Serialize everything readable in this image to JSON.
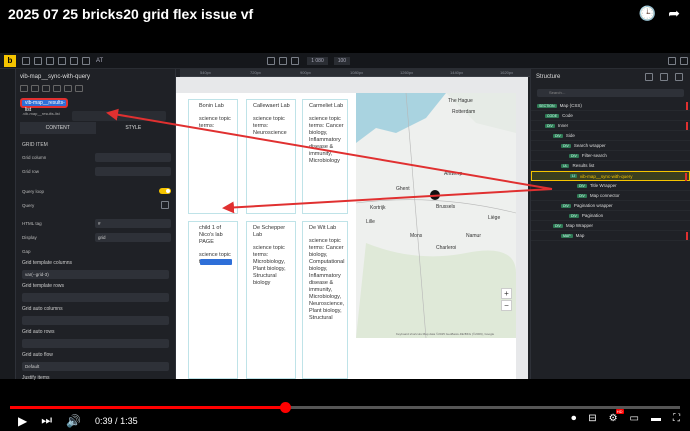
{
  "video": {
    "title": "2025 07 25 bricks20 grid flex issue vf",
    "time_current": "0:39",
    "time_separator": "/",
    "time_total": "1:35",
    "progress": 0.41
  },
  "builder": {
    "logo": "b",
    "toolbar_at": "AT",
    "width_label": "1 080",
    "zoom_label": "100",
    "element_title": "vib-map__sync-with-query",
    "class_chip": "vib-map__results-list",
    "class_sub": ".vib-map__results-list",
    "tabs": {
      "content": "CONTENT",
      "style": "STYLE"
    },
    "grid_item": {
      "heading": "GRID ITEM",
      "grid_column": "Grid column",
      "grid_row": "Grid row"
    },
    "query_loop": "Query loop",
    "query": "Query",
    "html_tag": {
      "label": "HTML tag",
      "value": "#"
    },
    "display": {
      "label": "Display",
      "value": "grid"
    },
    "gap": "Gap",
    "grid_template_columns": {
      "label": "Grid template columns",
      "value": "var(--grid-3)"
    },
    "grid_template_rows": "Grid template rows",
    "grid_auto_columns": "Grid auto columns",
    "grid_auto_rows": "Grid auto rows",
    "grid_auto_flow": {
      "label": "Grid auto flow",
      "value": "Default"
    },
    "justify_items": "Justify items"
  },
  "canvas": {
    "ruler_ticks": [
      "540px",
      "720px",
      "900px",
      "1080px",
      "1260px",
      "1440px",
      "1620px"
    ],
    "cards": [
      {
        "title": "Bonin Lab",
        "body": "science topic terms:"
      },
      {
        "title": "Callewaert Lab",
        "body": "science topic terms: Neuroscience"
      },
      {
        "title": "Carmeliet Lab",
        "body": "science topic terms: Cancer biology, Inflammatory disease & immunity, Microbiology"
      },
      {
        "title": "child 1 of Nico's lab PAGE",
        "body": "science topic terms:"
      },
      {
        "title": "De Schepper Lab",
        "body": "science topic terms: Microbiology, Plant biology, Structural biology"
      },
      {
        "title": "De Wit Lab",
        "body": "science topic terms: Cancer biology, Computational biology, Inflammatory disease & immunity, Microbiology, Neuroscience, Plant biology, Structural"
      }
    ],
    "map": {
      "labels": [
        "The Hague",
        "Rotterdam",
        "Antwerp",
        "Ghent",
        "Brussels",
        "Kortrijk",
        "Mons",
        "Namur",
        "Lille",
        "Charleroi",
        "Liège"
      ],
      "attribution": "Keyboard shortcuts   Map data ©2025 GeoBasis-DE/BKG (©2009), Google",
      "zoom_in": "+",
      "zoom_out": "−"
    }
  },
  "structure": {
    "title": "Structure",
    "search_placeholder": "Search…",
    "nodes": [
      {
        "tag": "SECTION",
        "label": "Map (CSS)",
        "indent": 0
      },
      {
        "tag": "CODE",
        "label": "Code",
        "indent": 1
      },
      {
        "tag": "DIV",
        "label": "Inner",
        "indent": 1
      },
      {
        "tag": "DIV",
        "label": "Side",
        "indent": 2
      },
      {
        "tag": "DIV",
        "label": "Search wrapper",
        "indent": 3
      },
      {
        "tag": "DIV",
        "label": "Filter-search",
        "indent": 4
      },
      {
        "tag": "UL",
        "label": "Results list",
        "indent": 3
      },
      {
        "tag": "LI",
        "label": "vib-map__sync-with-query",
        "indent": 4,
        "active": true
      },
      {
        "tag": "DIV",
        "label": "Title Wrapper",
        "indent": 5
      },
      {
        "tag": "DIV",
        "label": "Map connector",
        "indent": 5
      },
      {
        "tag": "DIV",
        "label": "Pagination wrapper",
        "indent": 3
      },
      {
        "tag": "DIV",
        "label": "Pagination",
        "indent": 4
      },
      {
        "tag": "DIV",
        "label": "Map Wrapper",
        "indent": 2
      },
      {
        "tag": "MAP",
        "label": "Map",
        "indent": 3
      }
    ]
  },
  "colors": {
    "accent": "#f5c400",
    "progress": "#ff0000",
    "annotation": "#e03030"
  }
}
